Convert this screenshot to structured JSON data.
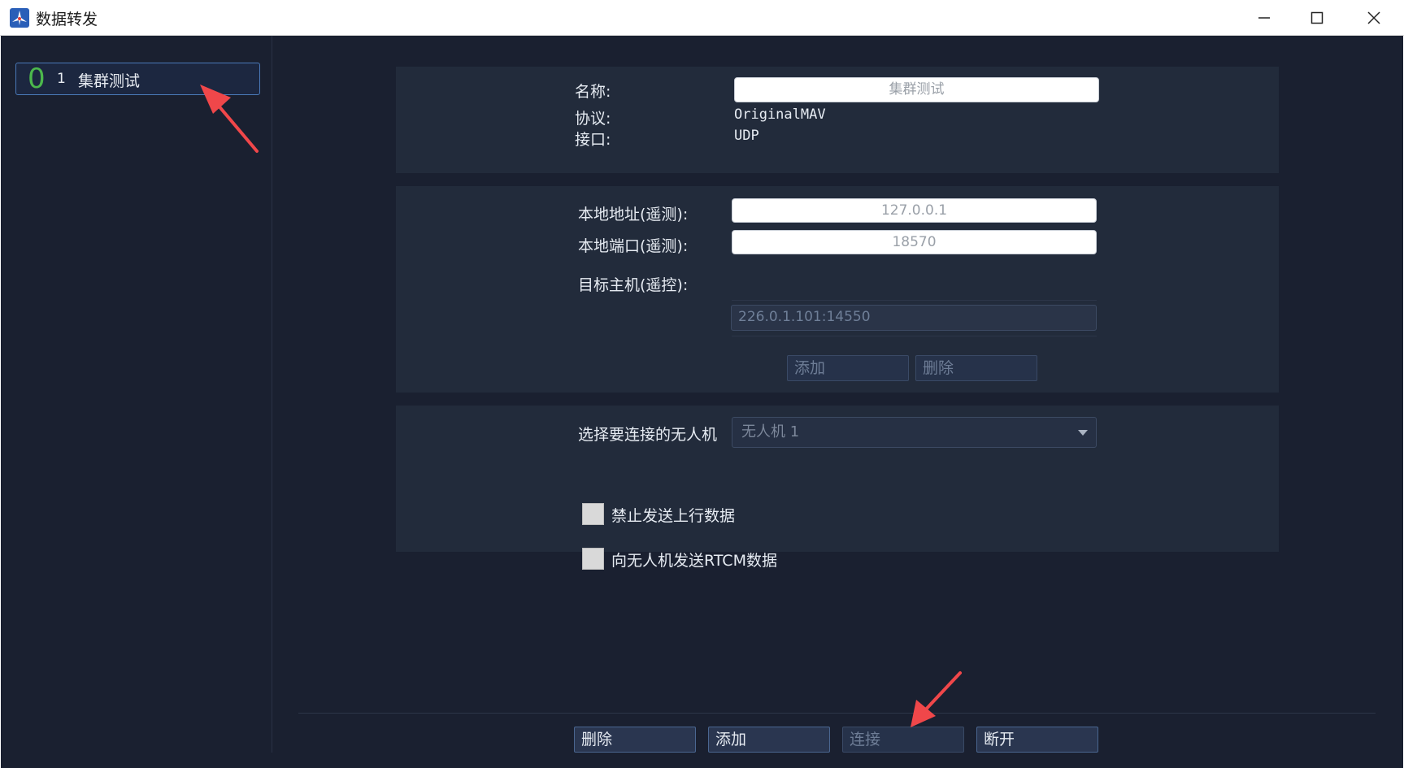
{
  "window": {
    "title": "数据转发"
  },
  "sidebar": {
    "items": [
      {
        "count": "0",
        "id": "1",
        "name": "集群测试"
      }
    ]
  },
  "info": {
    "name_label": "名称:",
    "name_value": "集群测试",
    "protocol_label": "协议:",
    "protocol_value": "OriginalMAV",
    "interface_label": "接口:",
    "interface_value": "UDP"
  },
  "network": {
    "local_address_label": "本地地址(遥测):",
    "local_address_value": "127.0.0.1",
    "local_port_label": "本地端口(遥测):",
    "local_port_value": "18570",
    "target_host_label": "目标主机(遥控):",
    "target_host_value": "226.0.1.101:14550",
    "add_label": "添加",
    "delete_label": "删除"
  },
  "drone": {
    "select_label": "选择要连接的无人机",
    "select_value": "无人机 1",
    "checkbox_uplink_label": "禁止发送上行数据",
    "checkbox_rtcm_label": "向无人机发送RTCM数据"
  },
  "footer": {
    "delete_label": "删除",
    "add_label": "添加",
    "connect_label": "连接",
    "disconnect_label": "断开"
  },
  "colors": {
    "background": "#1a2030",
    "panel": "#222b3b",
    "accent_border": "#4a79b8",
    "count_green": "#4cb84c",
    "annotation_arrow": "#f0474a"
  }
}
